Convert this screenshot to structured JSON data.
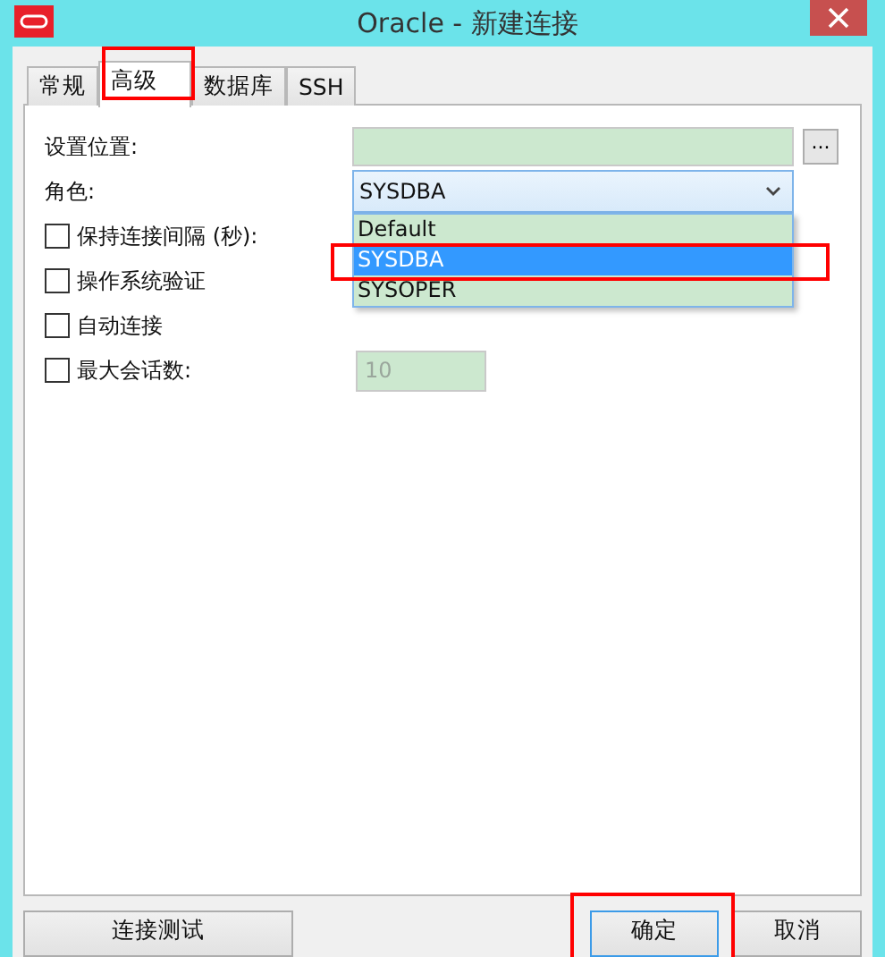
{
  "window": {
    "title": "Oracle - 新建连接"
  },
  "tabs": [
    {
      "label": "常规",
      "selected": false,
      "highlighted": false
    },
    {
      "label": "高级",
      "selected": true,
      "highlighted": true
    },
    {
      "label": "数据库",
      "selected": false,
      "highlighted": false
    },
    {
      "label": "SSH",
      "selected": false,
      "highlighted": false
    }
  ],
  "location": {
    "label": "设置位置:",
    "browse": "..."
  },
  "role": {
    "label": "角色:",
    "value": "SYSDBA",
    "expanded": true,
    "options": [
      {
        "label": "Default",
        "selected": false,
        "highlighted": false
      },
      {
        "label": "SYSDBA",
        "selected": true,
        "highlighted": true
      },
      {
        "label": "SYSOPER",
        "selected": false,
        "highlighted": false
      }
    ]
  },
  "settings": [
    {
      "label": "保持连接间隔 (秒):",
      "checked": false
    },
    {
      "label": "操作系统验证",
      "checked": false
    },
    {
      "label": "自动连接",
      "checked": false
    },
    {
      "label": "最大会话数:",
      "checked": false,
      "value": "10",
      "disabled": true
    }
  ],
  "buttons": [
    {
      "label": "连接测试",
      "kind": "wide",
      "default": false,
      "highlighted": false
    },
    {
      "label": "确定",
      "kind": "normal",
      "default": true,
      "highlighted": true
    },
    {
      "label": "取消",
      "kind": "normal",
      "default": false,
      "highlighted": false
    }
  ]
}
